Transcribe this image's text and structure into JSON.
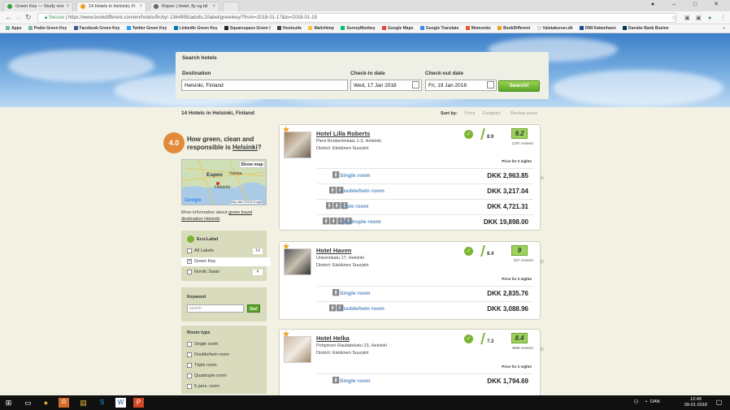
{
  "browser": {
    "tabs": [
      {
        "title": "Green Key — Study revi",
        "active": false
      },
      {
        "title": "14 Hotels in Helsinki, Fi",
        "active": true
      },
      {
        "title": "Rejser | Hotel, fly og bil",
        "active": false
      }
    ],
    "secure_label": "Secure",
    "url": "https://www.bookdifferent.com/en/hotels/fi/city/-1364995/adults:2/label/greenkey/?from=2018-01-17&to=2018-01-19",
    "bookmarks": [
      "Apps",
      "Podio Green Key",
      "Facebook Green Key",
      "Twitter Green Key",
      "LinkedIn Green Key",
      "Squarespace Green I",
      "Hootsuite",
      "Mailchimp",
      "SurveyMonkey",
      "Google Maps",
      "Google Translate",
      "Momondo",
      "BookDifferent",
      "Valutakurser.dk",
      "DMI København",
      "Danske Bank Busine"
    ]
  },
  "search": {
    "title": "Search hotels",
    "destination_label": "Destination",
    "destination_value": "Helsinki, Finland",
    "checkin_label": "Check-in date",
    "checkin_value": "Wed, 17 Jan 2018",
    "checkout_label": "Check-out date",
    "checkout_value": "Fri, 19 Jan 2018",
    "button": "Search!"
  },
  "results": {
    "count_label": "14 Hotels in Helsinki, Finland",
    "sort_label": "Sort by:",
    "sort_options": [
      "Price",
      "Footprint",
      "Review score"
    ]
  },
  "sidebar": {
    "score": "4.0",
    "question_prefix": "How green, clean and responsible is",
    "question_city": "Helsinki",
    "question_suffix": "?",
    "show_map": "Show map",
    "map_labels": {
      "espoo": "Espoo",
      "vantaa": "Vantaa",
      "helsinki": "Helsinki",
      "google": "Google",
      "mapdata": "Map data ©2018 Google"
    },
    "more_info_prefix": "More information about",
    "more_info_link": "green travel destination Helsinki",
    "eco_label_title": "Eco-Label",
    "eco_options": [
      {
        "label": "All Labels",
        "count": "14",
        "checked": false
      },
      {
        "label": "Green Key",
        "count": "",
        "checked": true
      },
      {
        "label": "Nordic Swan",
        "count": "4",
        "checked": false
      }
    ],
    "keyword_title": "Keyword",
    "keyword_placeholder": "search",
    "go_button": "Go!",
    "room_type_title": "Room type",
    "room_types": [
      "Single room",
      "Double/twin room",
      "Triple room",
      "Quadruple room",
      "5 pers. room"
    ]
  },
  "hotels": [
    {
      "name": "Hotel Lilla Roberts",
      "address": "Pieni Roobertinkatu 1-3, Helsinki",
      "district": "District: Eteläinen Suurpiiri",
      "green_score": "8.9",
      "review_score": "9.2",
      "reviews": "1297 reviews",
      "price_for": "Price for 2 nights",
      "rooms": [
        {
          "name": "Single room",
          "price": "DKK 2,963.85",
          "persons": "1"
        },
        {
          "name": "Double/twin room",
          "price": "DKK 3,217.04",
          "persons": "2"
        },
        {
          "name": "Triple room",
          "price": "DKK 4,721.31",
          "persons": "3"
        },
        {
          "name": "Quadruple room",
          "price": "DKK 19,898.00",
          "persons": "4"
        }
      ]
    },
    {
      "name": "Hotel Haven",
      "address": "Unioninkatu 17, Helsinki",
      "district": "District: Eteläinen Suurpiiri",
      "green_score": "8.4",
      "review_score": "9",
      "reviews": "837 reviews",
      "price_for": "Price for 2 nights",
      "rooms": [
        {
          "name": "Single room",
          "price": "DKK 2,835.76",
          "persons": "1"
        },
        {
          "name": "Double/twin room",
          "price": "DKK 3,088.96",
          "persons": "2"
        }
      ]
    },
    {
      "name": "Hotel Helka",
      "address": "Pohjoinen Rautatiekatu 23, Helsinki",
      "district": "District: Eteläinen Suurpiiri",
      "green_score": "7.3",
      "review_score": "8.4",
      "reviews": "3866 reviews",
      "price_for": "Price for 2 nights",
      "rooms": [
        {
          "name": "Single room",
          "price": "DKK 1,794.69",
          "persons": "1"
        }
      ]
    }
  ],
  "taskbar": {
    "time": "12:49",
    "date": "09-01-2018",
    "lang": "DAN"
  }
}
